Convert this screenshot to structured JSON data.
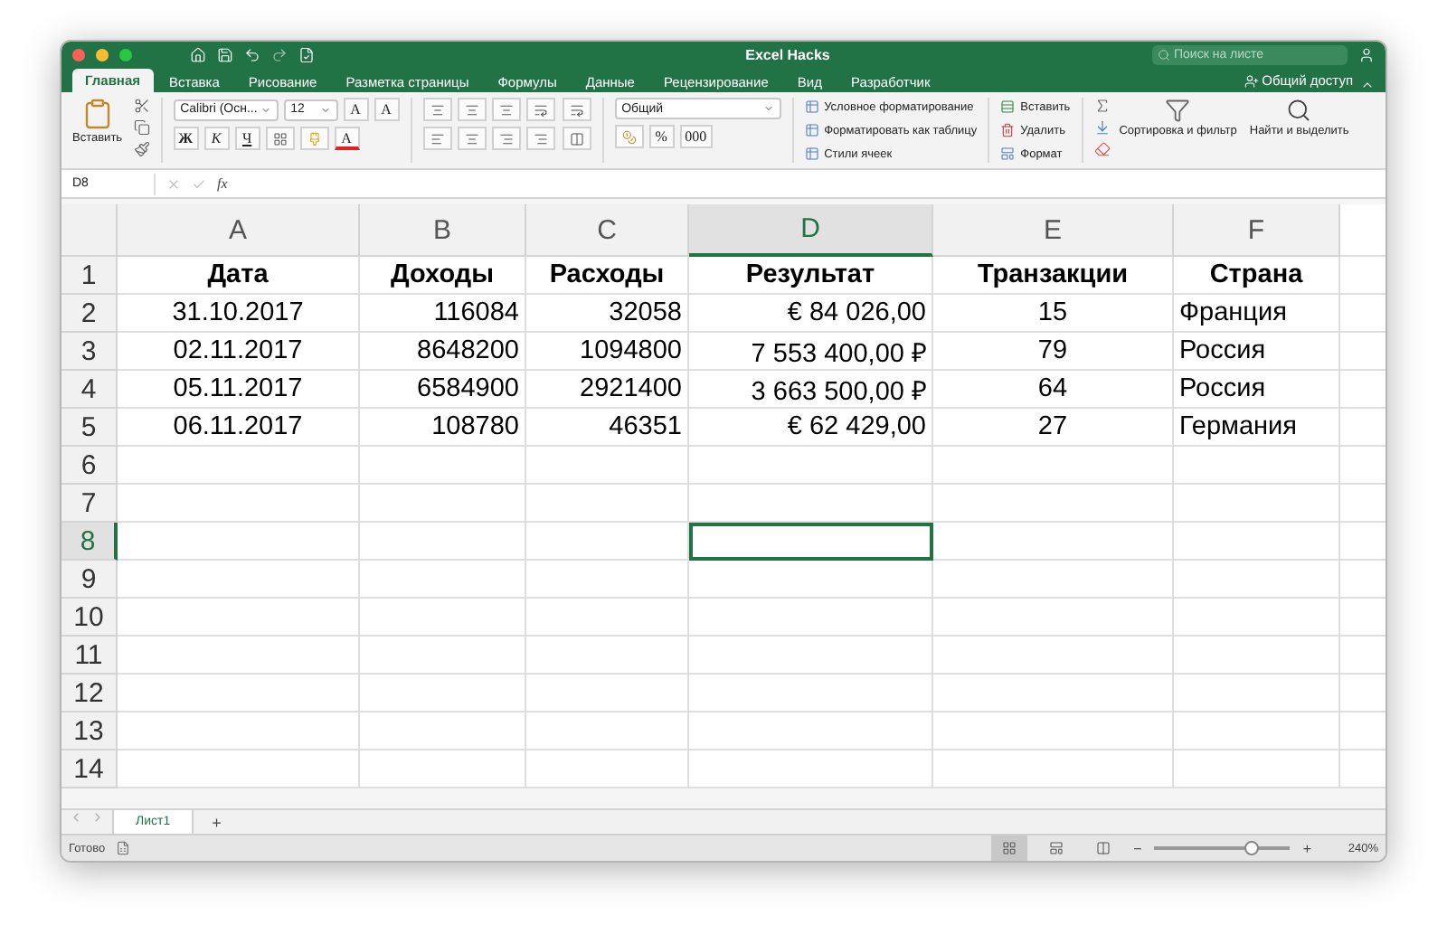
{
  "window": {
    "title": "Excel Hacks",
    "search": {
      "placeholder": "Поиск на листе"
    },
    "share": "Общий доступ"
  },
  "tabs": [
    {
      "label": "Главная",
      "selected": true
    },
    {
      "label": "Вставка",
      "selected": false
    },
    {
      "label": "Рисование",
      "selected": false
    },
    {
      "label": "Разметка страницы",
      "selected": false
    },
    {
      "label": "Формулы",
      "selected": false
    },
    {
      "label": "Данные",
      "selected": false
    },
    {
      "label": "Рецензирование",
      "selected": false
    },
    {
      "label": "Вид",
      "selected": false
    },
    {
      "label": "Разработчик",
      "selected": false
    }
  ],
  "ribbon": {
    "paste": "Вставить",
    "font": "Calibri (Осн...",
    "font_size": "12",
    "grow": "A",
    "shrink": "A",
    "bold": "Ж",
    "italic": "К",
    "underline": "Ч",
    "font_color": "A",
    "number_format": "Общий",
    "percent": "%",
    "thousands": "000",
    "styles": [
      "Условное форматирование",
      "Форматировать как таблицу",
      "Стили ячеек"
    ],
    "cells": [
      "Вставить",
      "Удалить",
      "Формат"
    ],
    "sort": "Сортировка и фильтр",
    "find": "Найти и выделить"
  },
  "formula_bar": {
    "name_box": "D8",
    "fx": "fx"
  },
  "sheet": {
    "columns": [
      {
        "label": "A",
        "selected": false
      },
      {
        "label": "B",
        "selected": false
      },
      {
        "label": "C",
        "selected": false
      },
      {
        "label": "D",
        "selected": true
      },
      {
        "label": "E",
        "selected": false
      },
      {
        "label": "F",
        "selected": false
      }
    ],
    "rows": [
      {
        "label": "1",
        "selected": false,
        "kind": "header",
        "cells": [
          "Дата",
          "Доходы",
          "Расходы",
          "Результат",
          "Транзакции",
          "Страна"
        ]
      },
      {
        "label": "2",
        "selected": false,
        "kind": "data",
        "cells": [
          "31.10.2017",
          "116084",
          "32058",
          "€ 84 026,00",
          "15",
          "Франция"
        ]
      },
      {
        "label": "3",
        "selected": false,
        "kind": "data",
        "cells": [
          "02.11.2017",
          "8648200",
          "1094800",
          "7 553 400,00 ₽",
          "79",
          "Россия"
        ]
      },
      {
        "label": "4",
        "selected": false,
        "kind": "data",
        "cells": [
          "05.11.2017",
          "6584900",
          "2921400",
          "3 663 500,00 ₽",
          "64",
          "Россия"
        ]
      },
      {
        "label": "5",
        "selected": false,
        "kind": "data",
        "cells": [
          "06.11.2017",
          "108780",
          "46351",
          "€ 62 429,00",
          "27",
          "Германия"
        ]
      },
      {
        "label": "6",
        "selected": false,
        "kind": "data"
      },
      {
        "label": "7",
        "selected": false,
        "kind": "data"
      },
      {
        "label": "8",
        "selected": true,
        "kind": "data"
      },
      {
        "label": "9",
        "selected": false,
        "kind": "data"
      },
      {
        "label": "10",
        "selected": false,
        "kind": "data"
      },
      {
        "label": "11",
        "selected": false,
        "kind": "data"
      },
      {
        "label": "12",
        "selected": false,
        "kind": "data"
      },
      {
        "label": "13",
        "selected": false,
        "kind": "data"
      },
      {
        "label": "14",
        "selected": false,
        "kind": "data"
      }
    ]
  },
  "sheet_tabs": [
    {
      "label": "Лист1",
      "selected": true
    }
  ],
  "add_sheet": "+",
  "status_bar": {
    "status": "Готово",
    "views": [
      {
        "selected": true
      },
      {
        "selected": false
      },
      {
        "selected": false
      }
    ],
    "zoom_out": "−",
    "zoom_in": "+",
    "zoom": {
      "level": 0.72,
      "reading": "240%"
    }
  }
}
